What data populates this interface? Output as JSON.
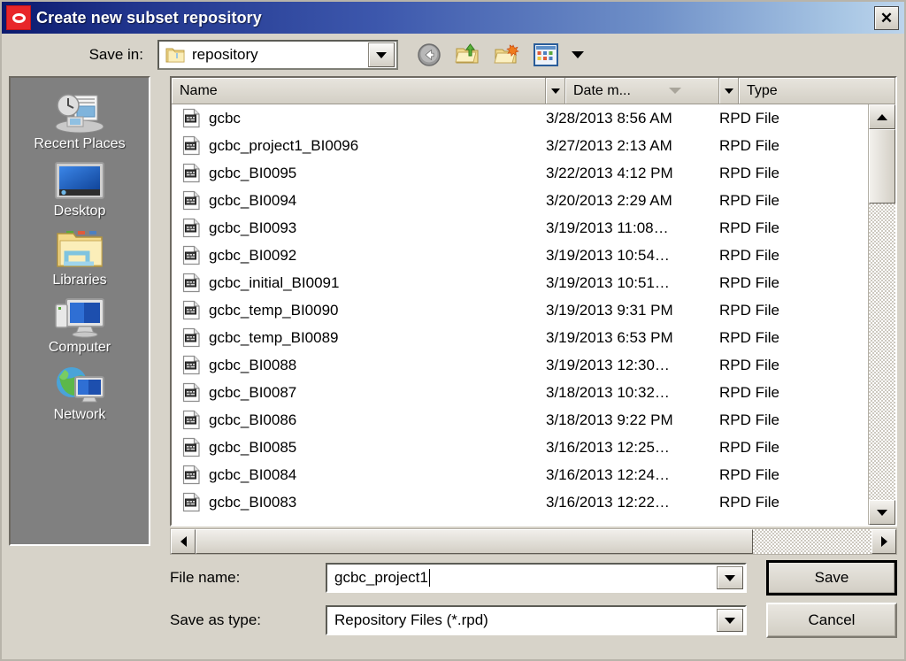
{
  "window": {
    "title": "Create new subset repository",
    "app_icon": "oracle-logo-icon",
    "close_label": "✕"
  },
  "savein": {
    "label": "Save in:",
    "value": "repository",
    "folder_icon": "folder-icon",
    "dropdown_icon": "chevron-down-icon"
  },
  "toolbar": {
    "back": "back-arrow-icon",
    "up": "up-one-level-icon",
    "new_folder": "new-folder-icon",
    "views": "views-icon",
    "views_caret": "chevron-down-icon"
  },
  "places": {
    "items": [
      {
        "label": "Recent Places",
        "icon": "recent-places-icon"
      },
      {
        "label": "Desktop",
        "icon": "desktop-icon"
      },
      {
        "label": "Libraries",
        "icon": "libraries-icon"
      },
      {
        "label": "Computer",
        "icon": "computer-icon"
      },
      {
        "label": "Network",
        "icon": "network-icon"
      }
    ]
  },
  "filelist": {
    "columns": [
      "Name",
      "Date m...",
      "Type"
    ],
    "sort_column": "Date m...",
    "sort_direction": "descending",
    "rows": [
      {
        "name": "gcbc",
        "date": "3/28/2013 8:56 AM",
        "type": "RPD File"
      },
      {
        "name": "gcbc_project1_BI0096",
        "date": "3/27/2013 2:13 AM",
        "type": "RPD File"
      },
      {
        "name": "gcbc_BI0095",
        "date": "3/22/2013 4:12 PM",
        "type": "RPD File"
      },
      {
        "name": "gcbc_BI0094",
        "date": "3/20/2013 2:29 AM",
        "type": "RPD File"
      },
      {
        "name": "gcbc_BI0093",
        "date": "3/19/2013 11:08…",
        "type": "RPD File"
      },
      {
        "name": "gcbc_BI0092",
        "date": "3/19/2013 10:54…",
        "type": "RPD File"
      },
      {
        "name": "gcbc_initial_BI0091",
        "date": "3/19/2013 10:51…",
        "type": "RPD File"
      },
      {
        "name": "gcbc_temp_BI0090",
        "date": "3/19/2013 9:31 PM",
        "type": "RPD File"
      },
      {
        "name": "gcbc_temp_BI0089",
        "date": "3/19/2013 6:53 PM",
        "type": "RPD File"
      },
      {
        "name": "gcbc_BI0088",
        "date": "3/19/2013 12:30…",
        "type": "RPD File"
      },
      {
        "name": "gcbc_BI0087",
        "date": "3/18/2013 10:32…",
        "type": "RPD File"
      },
      {
        "name": "gcbc_BI0086",
        "date": "3/18/2013 9:22 PM",
        "type": "RPD File"
      },
      {
        "name": "gcbc_BI0085",
        "date": "3/16/2013 12:25…",
        "type": "RPD File"
      },
      {
        "name": "gcbc_BI0084",
        "date": "3/16/2013 12:24…",
        "type": "RPD File"
      },
      {
        "name": "gcbc_BI0083",
        "date": "3/16/2013 12:22…",
        "type": "RPD File"
      }
    ]
  },
  "fields": {
    "filename_label": "File name:",
    "filename_value": "gcbc_project1",
    "filetype_label": "Save as type:",
    "filetype_value": "Repository Files (*.rpd)"
  },
  "buttons": {
    "save": "Save",
    "cancel": "Cancel"
  }
}
